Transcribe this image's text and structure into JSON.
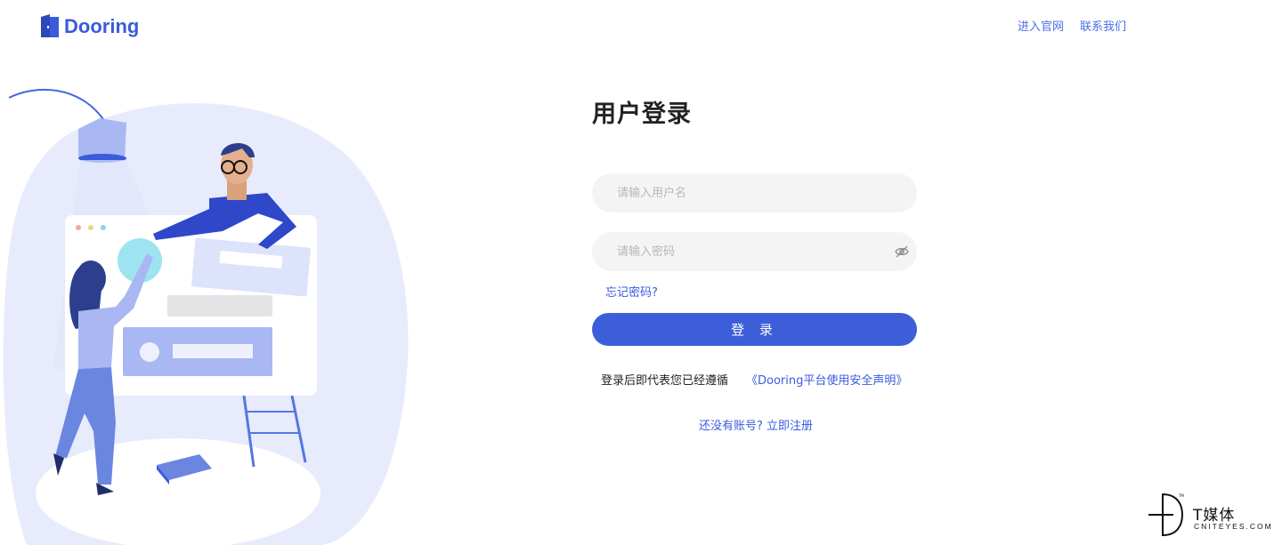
{
  "brand": {
    "name": "Dooring",
    "color": "#3b5bdb"
  },
  "nav": {
    "official_site": "进入官网",
    "contact": "联系我们"
  },
  "login": {
    "title": "用户登录",
    "username_placeholder": "请输入用户名",
    "password_placeholder": "请输入密码",
    "forgot_password": "忘记密码?",
    "submit": "登 录",
    "agreement_text": "登录后即代表您已经遵循",
    "agreement_link": "《Dooring平台使用安全声明》",
    "register": "还没有账号? 立即注册"
  },
  "icons": {
    "logo": "door-icon",
    "password_toggle": "eye-off-icon"
  },
  "watermark": {
    "chinese": "T媒体",
    "english": "CNITEYES.COM"
  }
}
